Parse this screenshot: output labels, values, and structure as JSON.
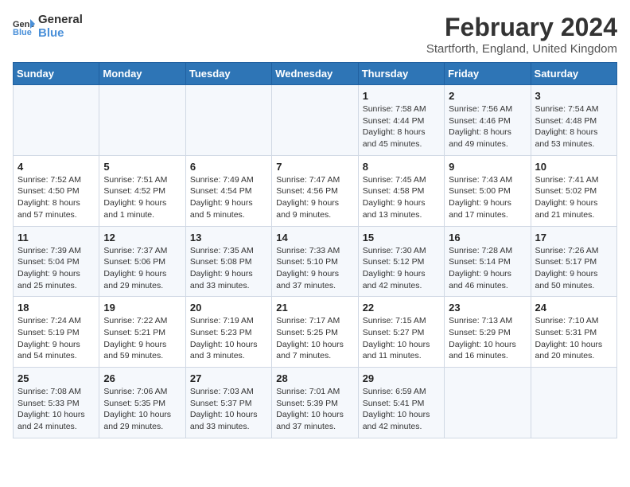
{
  "logo": {
    "line1": "General",
    "line2": "Blue"
  },
  "title": {
    "month_year": "February 2024",
    "location": "Startforth, England, United Kingdom"
  },
  "days_of_week": [
    "Sunday",
    "Monday",
    "Tuesday",
    "Wednesday",
    "Thursday",
    "Friday",
    "Saturday"
  ],
  "weeks": [
    [
      {
        "day": "",
        "content": ""
      },
      {
        "day": "",
        "content": ""
      },
      {
        "day": "",
        "content": ""
      },
      {
        "day": "",
        "content": ""
      },
      {
        "day": "1",
        "content": "Sunrise: 7:58 AM\nSunset: 4:44 PM\nDaylight: 8 hours\nand 45 minutes."
      },
      {
        "day": "2",
        "content": "Sunrise: 7:56 AM\nSunset: 4:46 PM\nDaylight: 8 hours\nand 49 minutes."
      },
      {
        "day": "3",
        "content": "Sunrise: 7:54 AM\nSunset: 4:48 PM\nDaylight: 8 hours\nand 53 minutes."
      }
    ],
    [
      {
        "day": "4",
        "content": "Sunrise: 7:52 AM\nSunset: 4:50 PM\nDaylight: 8 hours\nand 57 minutes."
      },
      {
        "day": "5",
        "content": "Sunrise: 7:51 AM\nSunset: 4:52 PM\nDaylight: 9 hours\nand 1 minute."
      },
      {
        "day": "6",
        "content": "Sunrise: 7:49 AM\nSunset: 4:54 PM\nDaylight: 9 hours\nand 5 minutes."
      },
      {
        "day": "7",
        "content": "Sunrise: 7:47 AM\nSunset: 4:56 PM\nDaylight: 9 hours\nand 9 minutes."
      },
      {
        "day": "8",
        "content": "Sunrise: 7:45 AM\nSunset: 4:58 PM\nDaylight: 9 hours\nand 13 minutes."
      },
      {
        "day": "9",
        "content": "Sunrise: 7:43 AM\nSunset: 5:00 PM\nDaylight: 9 hours\nand 17 minutes."
      },
      {
        "day": "10",
        "content": "Sunrise: 7:41 AM\nSunset: 5:02 PM\nDaylight: 9 hours\nand 21 minutes."
      }
    ],
    [
      {
        "day": "11",
        "content": "Sunrise: 7:39 AM\nSunset: 5:04 PM\nDaylight: 9 hours\nand 25 minutes."
      },
      {
        "day": "12",
        "content": "Sunrise: 7:37 AM\nSunset: 5:06 PM\nDaylight: 9 hours\nand 29 minutes."
      },
      {
        "day": "13",
        "content": "Sunrise: 7:35 AM\nSunset: 5:08 PM\nDaylight: 9 hours\nand 33 minutes."
      },
      {
        "day": "14",
        "content": "Sunrise: 7:33 AM\nSunset: 5:10 PM\nDaylight: 9 hours\nand 37 minutes."
      },
      {
        "day": "15",
        "content": "Sunrise: 7:30 AM\nSunset: 5:12 PM\nDaylight: 9 hours\nand 42 minutes."
      },
      {
        "day": "16",
        "content": "Sunrise: 7:28 AM\nSunset: 5:14 PM\nDaylight: 9 hours\nand 46 minutes."
      },
      {
        "day": "17",
        "content": "Sunrise: 7:26 AM\nSunset: 5:17 PM\nDaylight: 9 hours\nand 50 minutes."
      }
    ],
    [
      {
        "day": "18",
        "content": "Sunrise: 7:24 AM\nSunset: 5:19 PM\nDaylight: 9 hours\nand 54 minutes."
      },
      {
        "day": "19",
        "content": "Sunrise: 7:22 AM\nSunset: 5:21 PM\nDaylight: 9 hours\nand 59 minutes."
      },
      {
        "day": "20",
        "content": "Sunrise: 7:19 AM\nSunset: 5:23 PM\nDaylight: 10 hours\nand 3 minutes."
      },
      {
        "day": "21",
        "content": "Sunrise: 7:17 AM\nSunset: 5:25 PM\nDaylight: 10 hours\nand 7 minutes."
      },
      {
        "day": "22",
        "content": "Sunrise: 7:15 AM\nSunset: 5:27 PM\nDaylight: 10 hours\nand 11 minutes."
      },
      {
        "day": "23",
        "content": "Sunrise: 7:13 AM\nSunset: 5:29 PM\nDaylight: 10 hours\nand 16 minutes."
      },
      {
        "day": "24",
        "content": "Sunrise: 7:10 AM\nSunset: 5:31 PM\nDaylight: 10 hours\nand 20 minutes."
      }
    ],
    [
      {
        "day": "25",
        "content": "Sunrise: 7:08 AM\nSunset: 5:33 PM\nDaylight: 10 hours\nand 24 minutes."
      },
      {
        "day": "26",
        "content": "Sunrise: 7:06 AM\nSunset: 5:35 PM\nDaylight: 10 hours\nand 29 minutes."
      },
      {
        "day": "27",
        "content": "Sunrise: 7:03 AM\nSunset: 5:37 PM\nDaylight: 10 hours\nand 33 minutes."
      },
      {
        "day": "28",
        "content": "Sunrise: 7:01 AM\nSunset: 5:39 PM\nDaylight: 10 hours\nand 37 minutes."
      },
      {
        "day": "29",
        "content": "Sunrise: 6:59 AM\nSunset: 5:41 PM\nDaylight: 10 hours\nand 42 minutes."
      },
      {
        "day": "",
        "content": ""
      },
      {
        "day": "",
        "content": ""
      }
    ]
  ]
}
